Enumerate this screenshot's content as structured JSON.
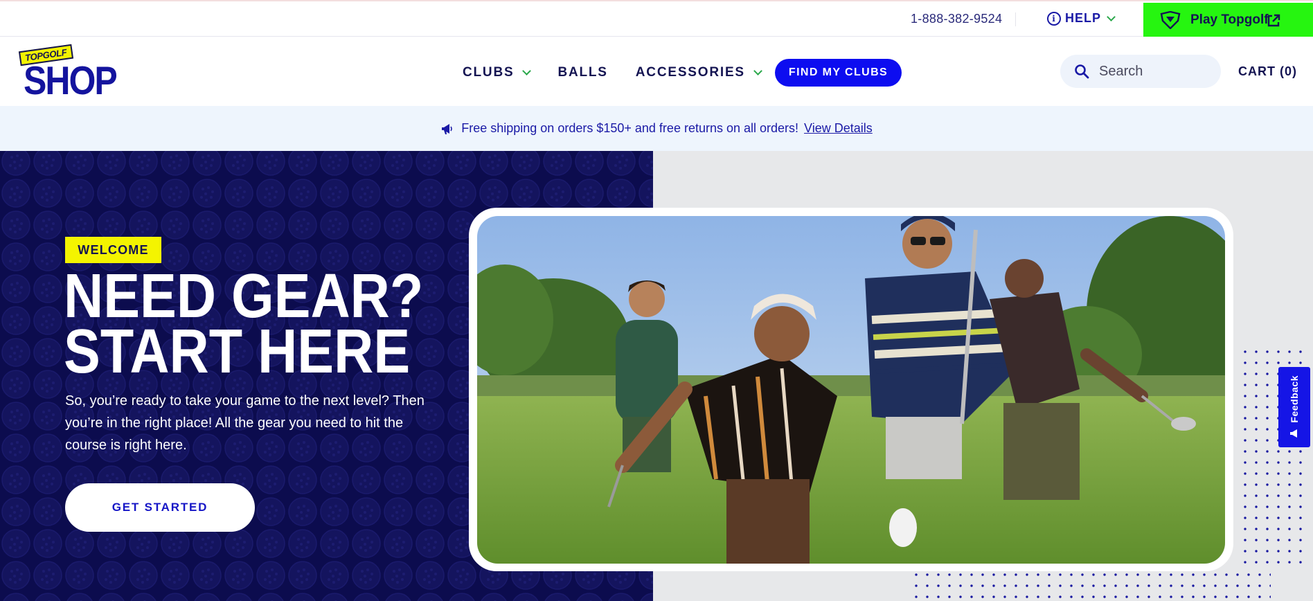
{
  "utility": {
    "phone": "1-888-382-9524",
    "help_label": "HELP",
    "play_label": "Play Topgolf"
  },
  "header": {
    "logo_top": "TOPGOLF",
    "logo_main": "SHOP",
    "nav": {
      "clubs": "CLUBS",
      "balls": "BALLS",
      "accessories": "ACCESSORIES",
      "find_clubs": "FIND MY CLUBS"
    },
    "search_placeholder": "Search",
    "cart": "CART (0)"
  },
  "promo": {
    "text": "Free shipping on orders $150+ and free returns on all orders!",
    "link": "View Details"
  },
  "hero": {
    "tag": "WELCOME",
    "title_line1": "NEED GEAR?",
    "title_line2": "START HERE",
    "body": "So, you’re ready to take your game to the next level? Then you’re in the right place! All the gear you need to hit the course is right here.",
    "cta": "GET STARTED"
  },
  "feedback": {
    "label": "Feedback"
  },
  "colors": {
    "navy": "#0c0c4e",
    "brand_blue": "#0d0df0",
    "play_green": "#26f510",
    "welcome_yellow": "#f4f400"
  }
}
